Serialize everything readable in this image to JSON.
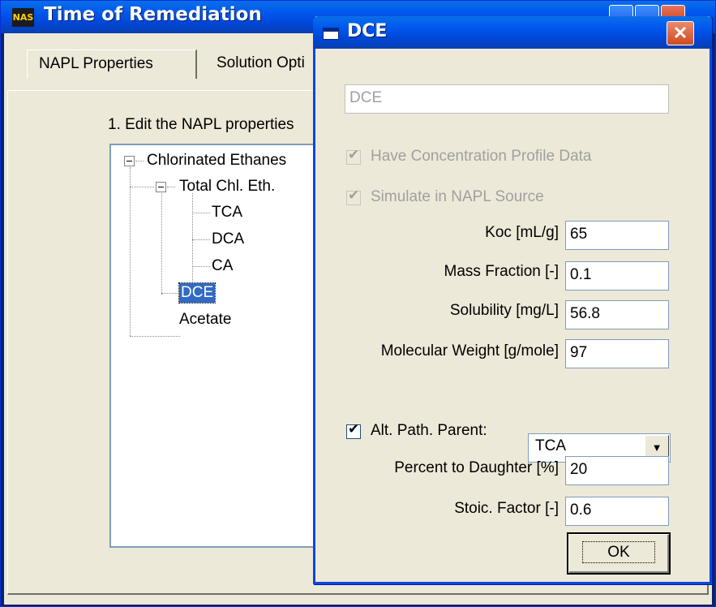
{
  "main_window": {
    "title": "Time of Remediation",
    "icon_label": "NAS",
    "tabs": [
      {
        "label": "NAPL Properties"
      },
      {
        "label": "Solution Opti"
      }
    ],
    "instruction": "1. Edit the NAPL properties"
  },
  "tree": {
    "root": "Chlorinated Ethanes",
    "group": "Total Chl. Eth.",
    "children": [
      "TCA",
      "DCA",
      "CA"
    ],
    "selected": "DCE",
    "last": "Acetate"
  },
  "dialog": {
    "title": "DCE",
    "close_label": "✕",
    "name_value": "DCE",
    "have_profile_label": "Have Concentration Profile Data",
    "simulate_label": "Simulate in NAPL Source",
    "koc_label": "Koc [mL/g]",
    "koc_value": "65",
    "mass_fraction_label": "Mass Fraction [-]",
    "mass_fraction_value": "0.1",
    "solubility_label": "Solubility [mg/L]",
    "solubility_value": "56.8",
    "mol_weight_label": "Molecular Weight [g/mole]",
    "mol_weight_value": "97",
    "alt_path_label": "Alt. Path. Parent:",
    "alt_path_value": "TCA",
    "percent_label": "Percent to Daughter [%]",
    "percent_value": "20",
    "stoic_label": "Stoic. Factor [-]",
    "stoic_value": "0.6",
    "ok_label": "OK"
  }
}
